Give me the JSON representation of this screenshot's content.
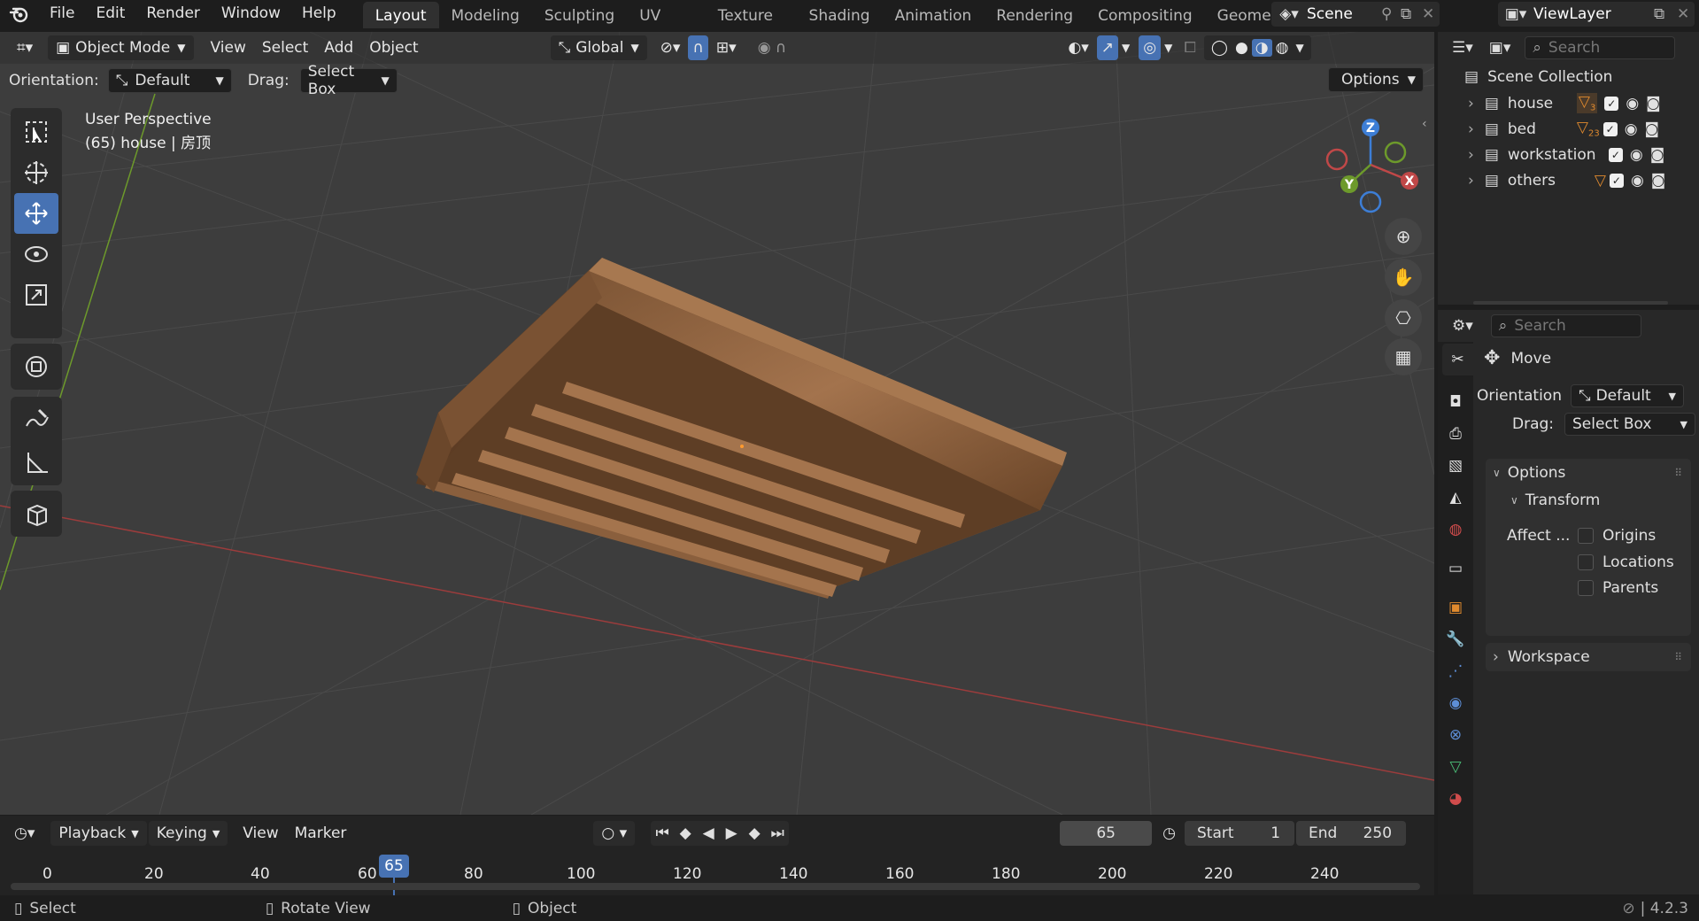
{
  "app": {
    "version": "4.2.3"
  },
  "menu": [
    "File",
    "Edit",
    "Render",
    "Window",
    "Help"
  ],
  "workspace_tabs": [
    "Layout",
    "Modeling",
    "Sculpting",
    "UV Editing",
    "Texture Paint",
    "Shading",
    "Animation",
    "Rendering",
    "Compositing",
    "Geome"
  ],
  "active_workspace": "Layout",
  "scene_name": "Scene",
  "view_layer": "ViewLayer",
  "viewport_header": {
    "mode": "Object Mode",
    "menus": [
      "View",
      "Select",
      "Add",
      "Object"
    ],
    "transform_orientation": "Global"
  },
  "tool_header": {
    "orientation_label": "Orientation:",
    "orientation_value": "Default",
    "drag_label": "Drag:",
    "drag_value": "Select Box",
    "options_label": "Options"
  },
  "viewport_info": {
    "line1": "User Perspective",
    "line2": "(65) house | 房顶"
  },
  "gizmo": {
    "z": "Z",
    "y": "Y",
    "x": "X"
  },
  "outliner": {
    "search_placeholder": "Search",
    "root": "Scene Collection",
    "collections": [
      {
        "name": "house",
        "badge": "3"
      },
      {
        "name": "bed",
        "badge": "23"
      },
      {
        "name": "workstation",
        "badge": ""
      },
      {
        "name": "others",
        "badge": ""
      }
    ]
  },
  "properties": {
    "search_placeholder": "Search",
    "tool_name": "Move",
    "orientation_label": "Orientation",
    "orientation_value": "Default",
    "drag_label": "Drag:",
    "drag_value": "Select Box",
    "options_label": "Options",
    "transform_label": "Transform",
    "affect_label": "Affect ...",
    "affect_options": [
      "Origins",
      "Locations",
      "Parents"
    ],
    "workspace_label": "Workspace"
  },
  "timeline": {
    "menus": [
      "Playback",
      "Keying",
      "View",
      "Marker"
    ],
    "current_frame": "65",
    "start_label": "Start",
    "start_value": "1",
    "end_label": "End",
    "end_value": "250",
    "ruler": [
      "0",
      "20",
      "40",
      "60",
      "65",
      "80",
      "100",
      "120",
      "140",
      "160",
      "180",
      "200",
      "220",
      "240"
    ]
  },
  "status": {
    "select": "Select",
    "rotate": "Rotate View",
    "object": "Object",
    "version": "4.2.3"
  },
  "colors": {
    "accent": "#4772b3",
    "viewport_bg": "#3d3d3d",
    "panel_bg": "#282828",
    "x_axis": "#c04848",
    "y_axis": "#6d9a2b",
    "z_axis": "#3d7ed6",
    "wood": "#9a6a44"
  }
}
